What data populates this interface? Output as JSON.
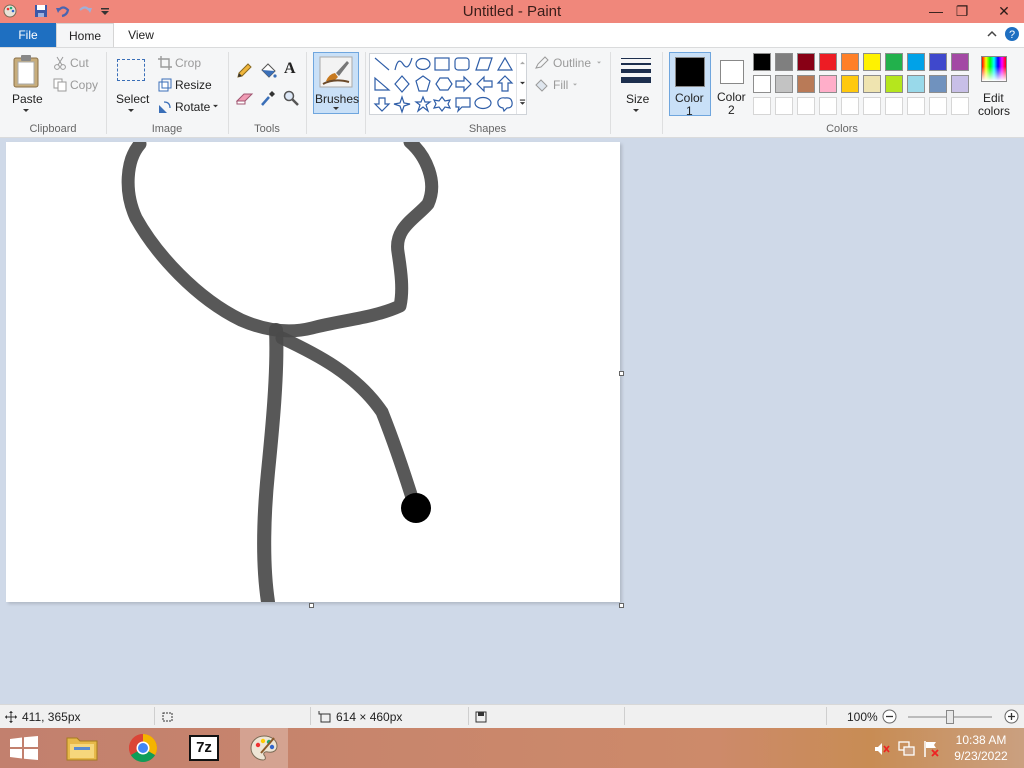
{
  "window": {
    "title": "Untitled - Paint"
  },
  "tabs": {
    "file": "File",
    "home": "Home",
    "view": "View"
  },
  "clipboard": {
    "paste": "Paste",
    "cut": "Cut",
    "copy": "Copy",
    "label": "Clipboard"
  },
  "image": {
    "select": "Select",
    "crop": "Crop",
    "resize": "Resize",
    "rotate": "Rotate",
    "label": "Image"
  },
  "tools": {
    "label": "Tools"
  },
  "brushes": {
    "label": "Brushes"
  },
  "shapes": {
    "outline": "Outline",
    "fill": "Fill",
    "label": "Shapes"
  },
  "size": {
    "label": "Size"
  },
  "color1": {
    "line1": "Color",
    "line2": "1",
    "value": "#000000"
  },
  "color2": {
    "line1": "Color",
    "line2": "2",
    "value": "#ffffff"
  },
  "colors": {
    "label": "Colors",
    "edit_line1": "Edit",
    "edit_line2": "colors",
    "palette_row1": [
      "#000000",
      "#7f7f7f",
      "#880015",
      "#ed1c24",
      "#ff7f27",
      "#fff200",
      "#22b14c",
      "#00a2e8",
      "#3f48cc",
      "#a349a4"
    ],
    "palette_row2": [
      "#ffffff",
      "#c3c3c3",
      "#b97a57",
      "#ffaec9",
      "#ffc90e",
      "#efe4b0",
      "#b5e61d",
      "#99d9ea",
      "#7092be",
      "#c8bfe7"
    ]
  },
  "status": {
    "cursor_pos": "411, 365px",
    "canvas_size": "614 × 460px",
    "zoom": "100%"
  },
  "taskbar": {
    "time": "10:38 AM",
    "date": "9/23/2022",
    "sevenzip": "7z"
  }
}
